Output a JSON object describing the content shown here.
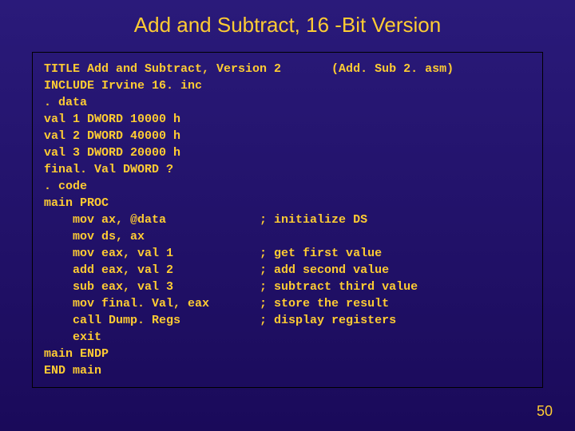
{
  "slide": {
    "title": "Add and Subtract, 16 -Bit Version",
    "page_number": "50"
  },
  "code": {
    "l1": "TITLE Add and Subtract, Version 2       (Add. Sub 2. asm)",
    "l2": "INCLUDE Irvine 16. inc",
    "l3": ". data",
    "l4": "val 1 DWORD 10000 h",
    "l5": "val 2 DWORD 40000 h",
    "l6": "val 3 DWORD 20000 h",
    "l7": "final. Val DWORD ?",
    "l8": ". code",
    "l9": "main PROC",
    "l10": "    mov ax, @data             ; initialize DS",
    "l11": "    mov ds, ax",
    "l12": "    mov eax, val 1            ; get first value",
    "l13": "    add eax, val 2            ; add second value",
    "l14": "    sub eax, val 3            ; subtract third value",
    "l15": "    mov final. Val, eax       ; store the result",
    "l16": "    call Dump. Regs           ; display registers",
    "l17": "    exit",
    "l18": "main ENDP",
    "l19": "END main"
  }
}
